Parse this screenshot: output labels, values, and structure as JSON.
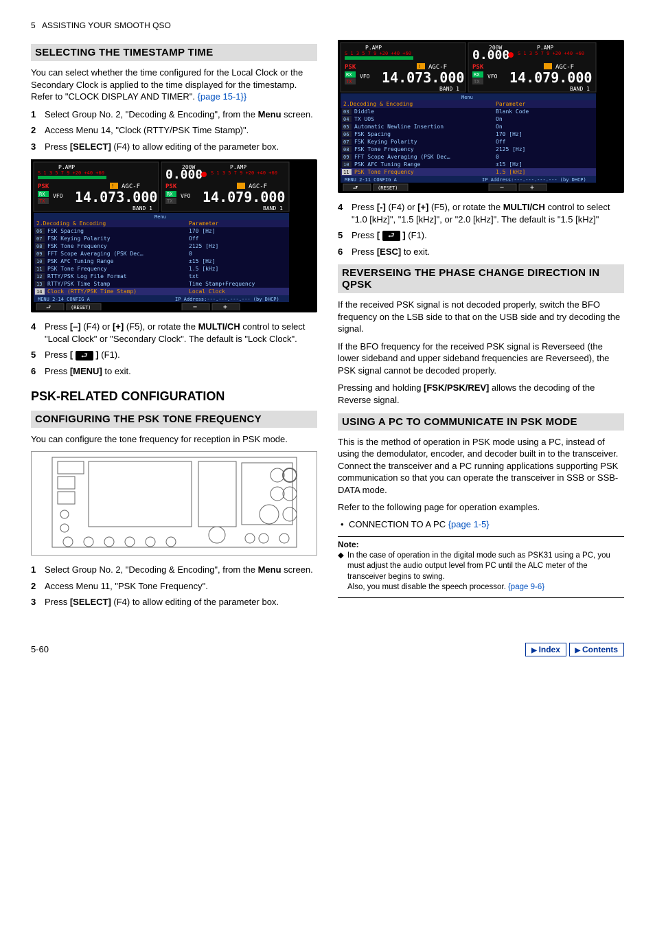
{
  "header": {
    "page_label": "5",
    "title": "ASSISTING YOUR SMOOTH QSO"
  },
  "left": {
    "sec1": {
      "title": "SELECTING THE TIMESTAMP TIME",
      "intro_a": "You can select whether the time configured for the Local Clock or the Secondary Clock is applied to the time displayed for the timestamp. Refer to \"CLOCK DISPLAY AND TIMER\". ",
      "intro_link": "{page 15-1}}",
      "s1_a": "Select Group No. 2, \"Decoding & Encoding\", from the ",
      "s1_b": "Menu",
      "s1_c": " screen.",
      "s2": "Access Menu 14, \"Clock (RTTY/PSK Time Stamp)\".",
      "s3_a": "Press ",
      "s3_b": "[SELECT]",
      "s3_c": " (F4) to allow editing of the parameter box.",
      "s4_a": "Press ",
      "s4_b": "[–]",
      "s4_c": " (F4) or ",
      "s4_d": "[+]",
      "s4_e": " (F5), or rotate the ",
      "s4_f": "MULTI/CH",
      "s4_g": " control to select \"Local Clock\" or \"Secondary Clock\". The default is \"Lock Clock\".",
      "s5_a": "Press ",
      "s5_b": "[",
      "s5_c": "]",
      "s5_d": " (F1).",
      "s6_a": "Press ",
      "s6_b": "[MENU]",
      "s6_c": " to exit."
    },
    "h1": "PSK-RELATED CONFIGURATION",
    "sec2": {
      "title": "CONFIGURING THE PSK TONE FREQUENCY",
      "intro": "You can configure the tone frequency for reception in PSK mode.",
      "s1_a": "Select Group No. 2, \"Decoding & Encoding\", from the ",
      "s1_b": "Menu",
      "s1_c": " screen.",
      "s2": "Access Menu 11, \"PSK Tone Frequency\".",
      "s3_a": "Press ",
      "s3_b": "[SELECT]",
      "s3_c": " (F4) to allow editing of the parameter box."
    }
  },
  "right": {
    "s4_a": "Press ",
    "s4_b": "[-]",
    "s4_c": " (F4) or ",
    "s4_d": "[+]",
    "s4_e": " (F5), or rotate the ",
    "s4_f": "MULTI/CH",
    "s4_g": " control to select \"1.0 [kHz]\", \"1.5 [kHz]\", or \"2.0 [kHz]\". The default is \"1.5 [kHz]\"",
    "s5_a": "Press ",
    "s5_b": "[",
    "s5_c": "]",
    "s5_d": " (F1).",
    "s6_a": "Press ",
    "s6_b": "[ESC]",
    "s6_c": " to exit.",
    "sec3": {
      "title": "REVERSEING THE PHASE CHANGE DIRECTION IN QPSK",
      "p1": "If the received PSK signal is not decoded properly, switch the BFO frequency on the LSB side to that on the USB side and try decoding the signal.",
      "p2": "If the BFO frequency for the received PSK signal is Reverseed (the lower sideband and upper sideband frequencies are Reverseed), the PSK signal cannot be decoded properly.",
      "p3_a": "Pressing and holding ",
      "p3_b": "[FSK/PSK/REV]",
      "p3_c": " allows the decoding of the Reverse signal."
    },
    "sec4": {
      "title": "USING A PC TO COMMUNICATE IN PSK MODE",
      "p1": "This is the method of operation in PSK mode using a PC, instead of using the demodulator, encoder, and decoder built in to the transceiver. Connect the transceiver and a PC running applications supporting PSK communication so that you can operate the transceiver in SSB or SSB-DATA mode.",
      "p2": "Refer to the following page for operation examples.",
      "bullet_a": "CONNECTION TO A PC ",
      "bullet_link": "{page 1-5}",
      "note_title": "Note:",
      "note1": "In the case of operation in the digital mode such as PSK31 using a PC, you must adjust the audio output level from PC until the ALC meter of the transceiver begins to swing.",
      "note2_a": "Also, you must disable the speech processor. ",
      "note2_link": "{page 9-6}"
    }
  },
  "menu1": {
    "left_header": [
      "P.AMP",
      "PSK",
      "RX",
      "TX",
      "VFO",
      "AGC-F",
      "14.073.000",
      "BAND 1"
    ],
    "right_header": [
      "200W",
      "P.AMP",
      "0.000",
      "PSK",
      "RX",
      "TX",
      "VFO",
      "AGC-F",
      "14.079.000",
      "BAND 1"
    ],
    "section_l": "2.Decoding & Encoding",
    "section_r": "Parameter",
    "rows": [
      {
        "n": "06",
        "l": "FSK Spacing",
        "r": "170 [Hz]"
      },
      {
        "n": "07",
        "l": "FSK Keying Polarity",
        "r": "Off"
      },
      {
        "n": "08",
        "l": "FSK Tone Frequency",
        "r": "2125 [Hz]"
      },
      {
        "n": "09",
        "l": "FFT Scope Averaging (PSK Dec…",
        "r": "0"
      },
      {
        "n": "10",
        "l": "PSK AFC Tuning Range",
        "r": "±15 [Hz]"
      },
      {
        "n": "11",
        "l": "PSK Tone Frequency",
        "r": "1.5 [kHz]"
      },
      {
        "n": "12",
        "l": "RTTY/PSK Log File Format",
        "r": "txt"
      },
      {
        "n": "13",
        "l": "RTTY/PSK Time Stamp",
        "r": "Time Stamp+Frequency"
      },
      {
        "n": "14",
        "l": "Clock (RTTY/PSK Time Stamp)",
        "r": "Local Clock",
        "hilite": true
      }
    ],
    "status": "MENU 2-14        CONFIG A",
    "ip": "IP Address:---.---.---.---  (by DHCP)",
    "btn_reset": "(RESET)"
  },
  "menu2": {
    "section_l": "2.Decoding & Encoding",
    "section_r": "Parameter",
    "rows": [
      {
        "n": "03",
        "l": "Diddle",
        "r": "Blank Code"
      },
      {
        "n": "04",
        "l": "TX UOS",
        "r": "On"
      },
      {
        "n": "05",
        "l": "Automatic Newline Insertion",
        "r": "On"
      },
      {
        "n": "06",
        "l": "FSK Spacing",
        "r": "170 [Hz]"
      },
      {
        "n": "07",
        "l": "FSK Keying Polarity",
        "r": "Off"
      },
      {
        "n": "08",
        "l": "FSK Tone Frequency",
        "r": "2125 [Hz]"
      },
      {
        "n": "09",
        "l": "FFT Scope Averaging (PSK Dec…",
        "r": "0"
      },
      {
        "n": "10",
        "l": "PSK AFC Tuning Range",
        "r": "±15 [Hz]"
      },
      {
        "n": "11",
        "l": "PSK Tone Frequency",
        "r": "1.5 [kHz]",
        "hilite": true
      }
    ],
    "status": "MENU 2-11        CONFIG A",
    "ip": "IP Address:---.---.---.---  (by DHCP)",
    "btn_reset": "(RESET)"
  },
  "footer": {
    "page": "5-60",
    "btn1": "Index",
    "btn2": "Contents"
  }
}
